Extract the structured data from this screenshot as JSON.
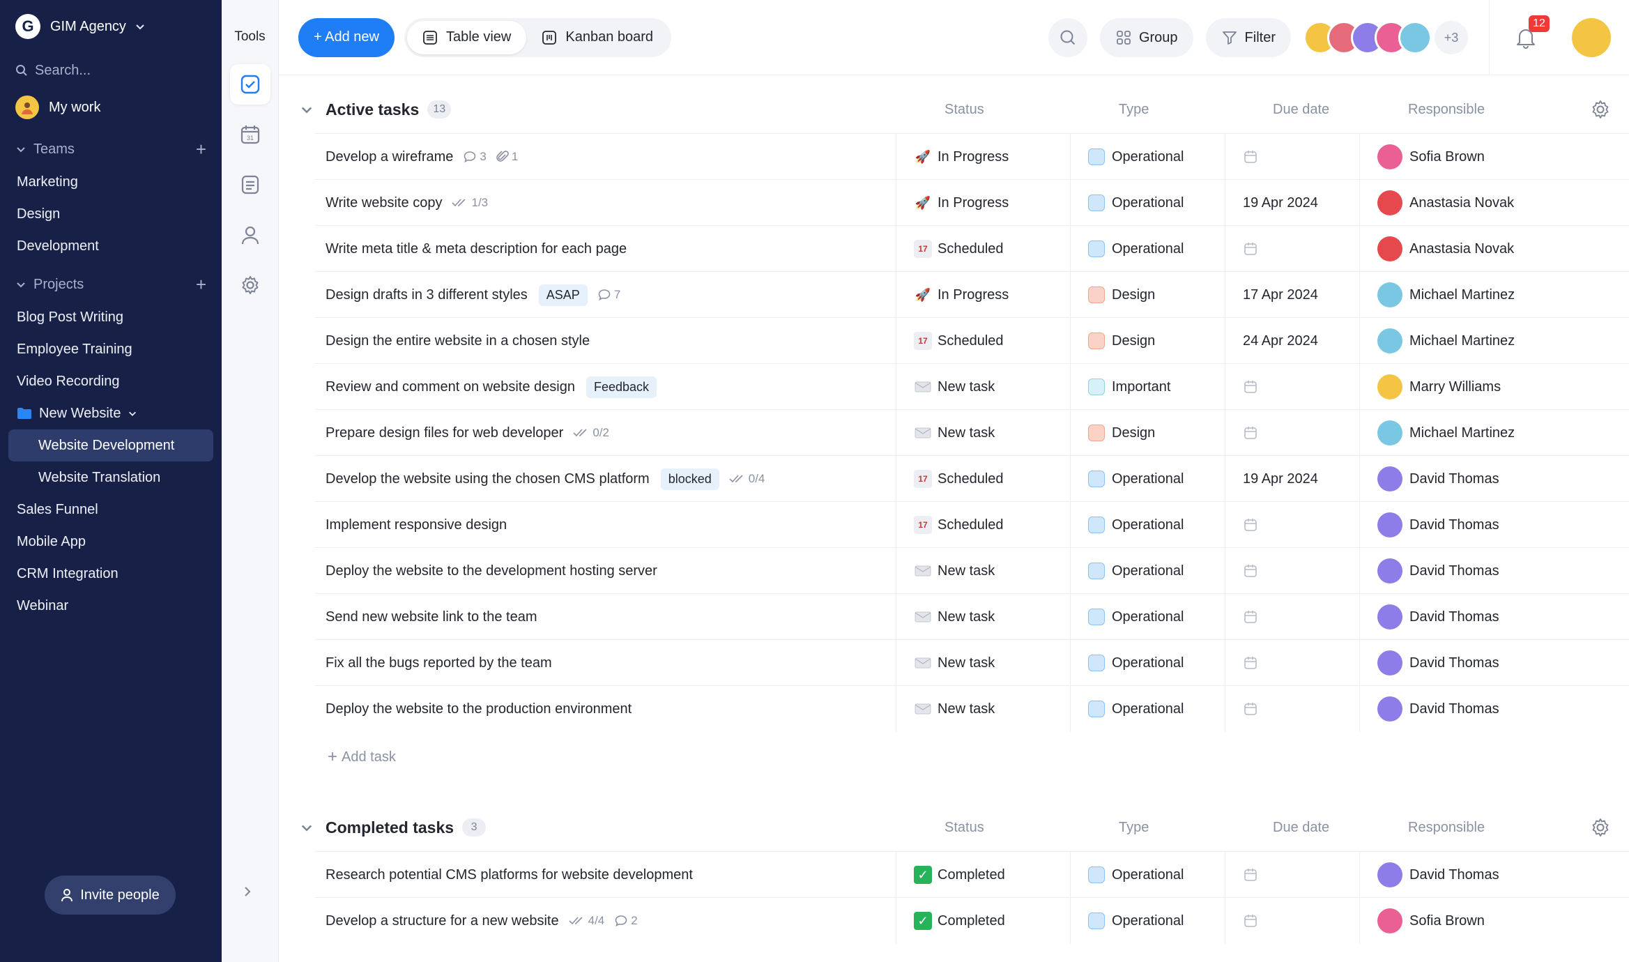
{
  "workspace": {
    "name": "GIM Agency",
    "logo_letter": "G"
  },
  "sidebar": {
    "search_placeholder": "Search...",
    "my_work": "My work",
    "teams_label": "Teams",
    "teams": [
      "Marketing",
      "Design",
      "Development"
    ],
    "projects_label": "Projects",
    "projects": [
      "Blog Post Writing",
      "Employee Training",
      "Video Recording"
    ],
    "folder": "New Website",
    "folder_items": [
      "Website Development",
      "Website Translation"
    ],
    "projects_after": [
      "Sales Funnel",
      "Mobile App",
      "CRM Integration",
      "Webinar"
    ],
    "invite": "Invite people"
  },
  "tools": {
    "title": "Tools"
  },
  "topbar": {
    "add_new": "+ Add new",
    "table_view": "Table view",
    "kanban_board": "Kanban board",
    "group": "Group",
    "filter": "Filter",
    "more_members": "+3",
    "notifications": "12"
  },
  "columns": {
    "status": "Status",
    "type": "Type",
    "due": "Due date",
    "responsible": "Responsible"
  },
  "active": {
    "title": "Active tasks",
    "count": "13",
    "add_task": "Add task",
    "rows": [
      {
        "name": "Develop a wireframe",
        "tag": "",
        "checks": "",
        "comments": "3",
        "attach": "1",
        "status": "In Progress",
        "type": "Operational",
        "due": "",
        "resp": "Sofia Brown"
      },
      {
        "name": "Write website copy",
        "tag": "",
        "checks": "1/3",
        "comments": "",
        "attach": "",
        "status": "In Progress",
        "type": "Operational",
        "due": "19 Apr 2024",
        "resp": "Anastasia Novak"
      },
      {
        "name": "Write meta title & meta description for each page",
        "tag": "",
        "checks": "",
        "comments": "",
        "attach": "",
        "status": "Scheduled",
        "type": "Operational",
        "due": "",
        "resp": "Anastasia Novak"
      },
      {
        "name": "Design drafts in 3 different styles",
        "tag": "ASAP",
        "checks": "",
        "comments": "7",
        "attach": "",
        "status": "In Progress",
        "type": "Design",
        "due": "17 Apr 2024",
        "resp": "Michael Martinez"
      },
      {
        "name": "Design the entire website in a chosen style",
        "tag": "",
        "checks": "",
        "comments": "",
        "attach": "",
        "status": "Scheduled",
        "type": "Design",
        "due": "24 Apr 2024",
        "resp": "Michael Martinez"
      },
      {
        "name": "Review and comment on website design",
        "tag": "Feedback",
        "checks": "",
        "comments": "",
        "attach": "",
        "status": "New task",
        "type": "Important",
        "due": "",
        "resp": "Marry Williams"
      },
      {
        "name": "Prepare design files for web developer",
        "tag": "",
        "checks": "0/2",
        "comments": "",
        "attach": "",
        "status": "New task",
        "type": "Design",
        "due": "",
        "resp": "Michael Martinez"
      },
      {
        "name": "Develop the website using the chosen CMS platform",
        "tag": "blocked",
        "checks": "0/4",
        "comments": "",
        "attach": "",
        "status": "Scheduled",
        "type": "Operational",
        "due": "19 Apr 2024",
        "resp": "David Thomas"
      },
      {
        "name": "Implement responsive design",
        "tag": "",
        "checks": "",
        "comments": "",
        "attach": "",
        "status": "Scheduled",
        "type": "Operational",
        "due": "",
        "resp": "David Thomas"
      },
      {
        "name": "Deploy the website to the development hosting server",
        "tag": "",
        "checks": "",
        "comments": "",
        "attach": "",
        "status": "New task",
        "type": "Operational",
        "due": "",
        "resp": "David Thomas"
      },
      {
        "name": "Send new website link to the team",
        "tag": "",
        "checks": "",
        "comments": "",
        "attach": "",
        "status": "New task",
        "type": "Operational",
        "due": "",
        "resp": "David Thomas"
      },
      {
        "name": "Fix all the bugs reported by the team",
        "tag": "",
        "checks": "",
        "comments": "",
        "attach": "",
        "status": "New task",
        "type": "Operational",
        "due": "",
        "resp": "David Thomas"
      },
      {
        "name": "Deploy the website to the production environment",
        "tag": "",
        "checks": "",
        "comments": "",
        "attach": "",
        "status": "New task",
        "type": "Operational",
        "due": "",
        "resp": "David Thomas"
      }
    ]
  },
  "completed": {
    "title": "Completed tasks",
    "count": "3",
    "rows": [
      {
        "name": "Research potential CMS platforms for website development",
        "tag": "",
        "checks": "",
        "comments": "",
        "attach": "",
        "status": "Completed",
        "type": "Operational",
        "due": "",
        "resp": "David Thomas"
      },
      {
        "name": "Develop a structure for a new website",
        "tag": "",
        "checks": "4/4",
        "comments": "2",
        "attach": "",
        "status": "Completed",
        "type": "Operational",
        "due": "",
        "resp": "Sofia Brown"
      }
    ]
  },
  "colors": {
    "accent": "#1f7df5",
    "sidebar_bg": "#172147",
    "type_operational": "#cfe6fb",
    "type_design": "#fbd3c6",
    "type_important": "#d6f1f7"
  }
}
